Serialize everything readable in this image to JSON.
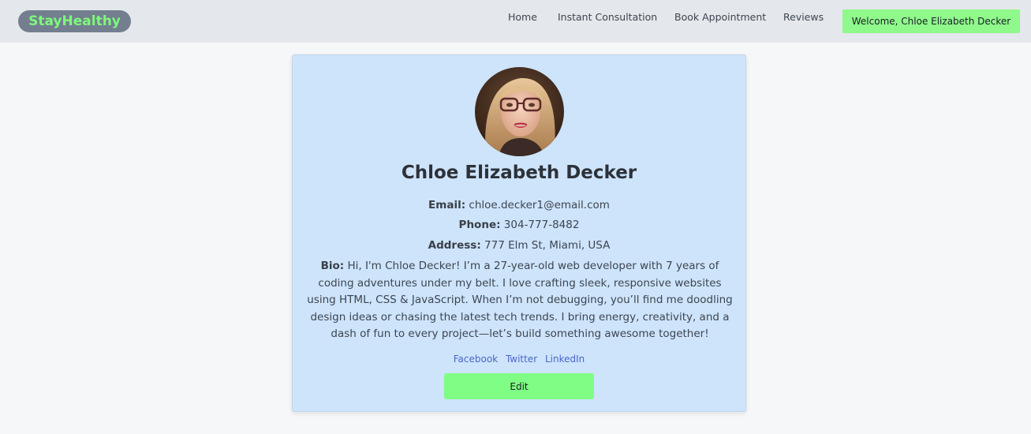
{
  "navbar": {
    "logo": "StayHealthy",
    "links": [
      {
        "label": "Home"
      },
      {
        "label": "Instant Consultation"
      },
      {
        "label": "Book Appointment"
      },
      {
        "label": "Reviews"
      }
    ],
    "welcome_label": "Welcome, Chloe Elizabeth Decker"
  },
  "profile": {
    "avatar_icon": "profile-photo",
    "name": "Chloe Elizabeth Decker",
    "email_label": "Email:",
    "email": "chloe.decker1@email.com",
    "phone_label": "Phone:",
    "phone": "304-777-8482",
    "address_label": "Address:",
    "address": "777 Elm St, Miami, USA",
    "bio_label": "Bio:",
    "bio": "Hi, I'm Chloe Decker! I’m a 27-year-old web developer with 7 years of coding adventures under my belt. I love crafting sleek, responsive websites using HTML, CSS & JavaScript. When I’m not debugging, you’ll find me doodling design ideas or chasing the latest tech trends. I bring energy, creativity, and a dash of fun to every project—let’s build something awesome together!",
    "socials": [
      {
        "label": "Facebook"
      },
      {
        "label": "Twitter"
      },
      {
        "label": "LinkedIn"
      }
    ],
    "edit_label": "Edit"
  },
  "colors": {
    "page_bg": "#f6f7f9",
    "navbar_bg": "#e4e7ec",
    "logo_bg": "#737f8f",
    "logo_text": "#7dfa7a",
    "welcome_bg": "#8ff98c",
    "card_bg": "#cde4fb",
    "link": "#4a67c6",
    "edit_bg": "#80fd84"
  }
}
